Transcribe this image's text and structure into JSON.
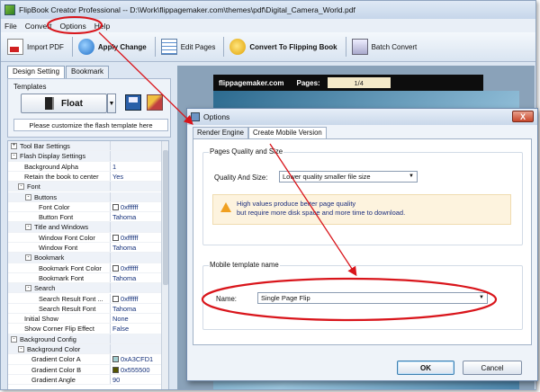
{
  "window": {
    "title": "FlipBook Creator Professional  -- D:\\Work\\flippagemaker.com\\themes\\pdf\\Digital_Camera_World.pdf"
  },
  "menu": [
    "File",
    "Convert",
    "Options",
    "Help"
  ],
  "toolbar": {
    "import_pdf": "Import PDF",
    "apply_change": "Apply Change",
    "edit_pages": "Edit Pages",
    "convert": "Convert To Flipping Book",
    "batch_convert": "Batch Convert"
  },
  "left_panel": {
    "tabs": [
      "Design Setting",
      "Bookmark"
    ],
    "templates_label": "Templates",
    "template_name": "Float",
    "customize_note": "Please customize the flash template here"
  },
  "properties": [
    {
      "name": "Tool Bar Settings",
      "value": "",
      "level": 0,
      "toggle": "+"
    },
    {
      "name": "Flash Display Settings",
      "value": "",
      "level": 0,
      "toggle": "-"
    },
    {
      "name": "Background Alpha",
      "value": "1",
      "level": 1
    },
    {
      "name": "Retain the book to center",
      "value": "Yes",
      "level": 1
    },
    {
      "name": "Font",
      "value": "",
      "level": 1,
      "toggle": "-"
    },
    {
      "name": "Buttons",
      "value": "",
      "level": 2,
      "toggle": "-"
    },
    {
      "name": "Font Color",
      "value": "0xffffff",
      "level": 3,
      "swatch": "#ffffff"
    },
    {
      "name": "Button Font",
      "value": "Tahoma",
      "level": 3
    },
    {
      "name": "Title and Windows",
      "value": "",
      "level": 2,
      "toggle": "-"
    },
    {
      "name": "Window Font Color",
      "value": "0xffffff",
      "level": 3,
      "swatch": "#ffffff"
    },
    {
      "name": "Window Font",
      "value": "Tahoma",
      "level": 3
    },
    {
      "name": "Bookmark",
      "value": "",
      "level": 2,
      "toggle": "-"
    },
    {
      "name": "Bookmark Font Color",
      "value": "0xffffff",
      "level": 3,
      "swatch": "#ffffff"
    },
    {
      "name": "Bookmark Font",
      "value": "Tahoma",
      "level": 3
    },
    {
      "name": "Search",
      "value": "",
      "level": 2,
      "toggle": "-"
    },
    {
      "name": "Search Result Font ...",
      "value": "0xffffff",
      "level": 3,
      "swatch": "#ffffff"
    },
    {
      "name": "Search Result Font",
      "value": "Tahoma",
      "level": 3
    },
    {
      "name": "Initial Show",
      "value": "None",
      "level": 1
    },
    {
      "name": "Show Corner Flip Effect",
      "value": "False",
      "level": 1
    },
    {
      "name": "Background Config",
      "value": "",
      "level": 0,
      "toggle": "-"
    },
    {
      "name": "Background Color",
      "value": "",
      "level": 1,
      "toggle": "-"
    },
    {
      "name": "Gradient Color A",
      "value": "0xA3CFD1",
      "level": 2,
      "swatch": "#A3CFD1"
    },
    {
      "name": "Gradient Color B",
      "value": "0x555500",
      "level": 2,
      "swatch": "#555500"
    },
    {
      "name": "Gradient Angle",
      "value": "90",
      "level": 2
    }
  ],
  "preview": {
    "site": "flippagemaker.com",
    "pages_label": "Pages:",
    "page_value": "1/4"
  },
  "dialog": {
    "title": "Options",
    "tabs": [
      "Render Engine",
      "Create Mobile Version"
    ],
    "quality_group": "Pages Quality and Size",
    "quality_label": "Quality And Size:",
    "quality_value": "Lower quality smaller file size",
    "warning_line1": "High values produce better page quality",
    "warning_line2": "but require more disk space and more time to download.",
    "mobile_group": "Mobile template name",
    "name_label": "Name:",
    "name_value": "Single Page Flip",
    "ok": "OK",
    "cancel": "Cancel",
    "close": "X"
  },
  "colors": {
    "annotation": "#d9151b",
    "toolbar_bg": "#dce6f2",
    "warning_bg": "#fdf3de"
  }
}
